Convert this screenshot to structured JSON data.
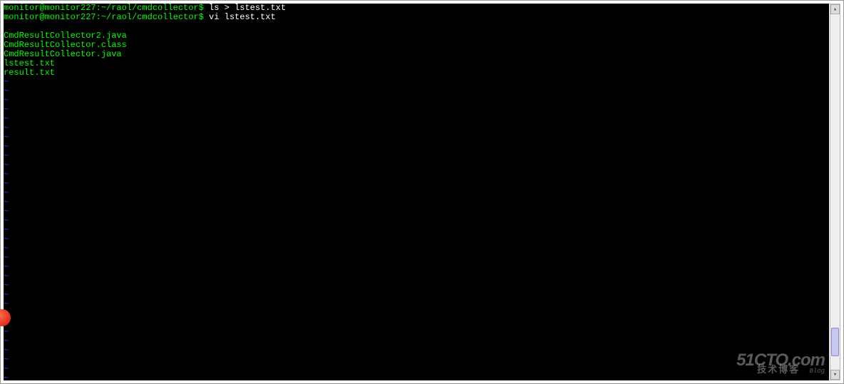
{
  "terminal": {
    "prompts": [
      {
        "prompt": "monitor@monitor227:~/raol/cmdcollector$ ",
        "cmd": "ls > lstest.txt"
      },
      {
        "prompt": "monitor@monitor227:~/raol/cmdcollector$ ",
        "cmd": "vi lstest.txt"
      }
    ],
    "file_lines": [
      "CmdResultCollector2.java",
      "CmdResultCollector.class",
      "CmdResultCollector.java",
      "lstest.txt",
      "result.txt"
    ],
    "tilde": "~",
    "tilde_count": 33
  },
  "watermark": {
    "line1": "51CTO.com",
    "line2": "技术博客",
    "blog": "Blog"
  }
}
